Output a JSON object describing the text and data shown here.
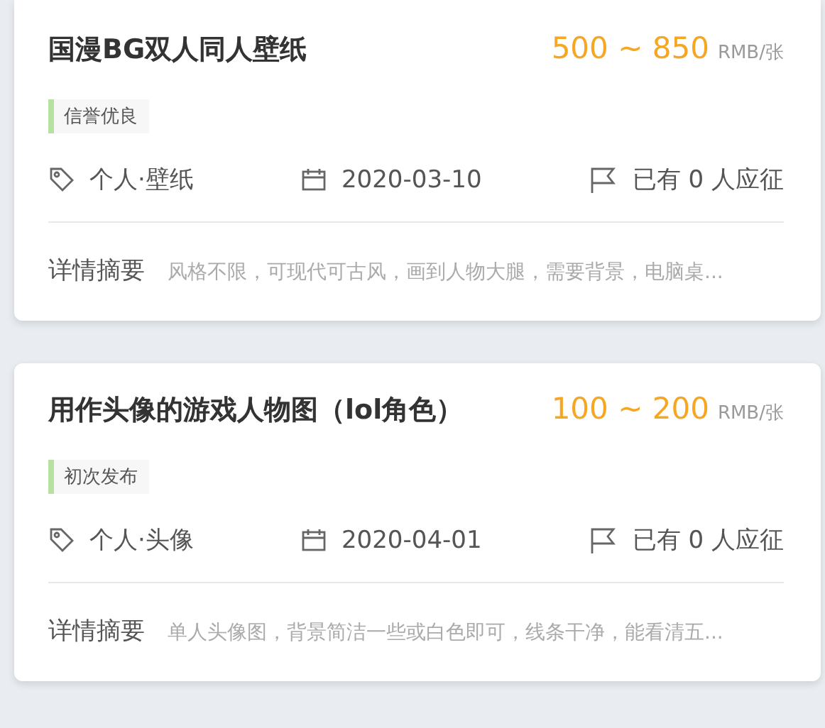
{
  "jobs": [
    {
      "title": "国漫BG双人同人壁纸",
      "price": "500 ~ 850",
      "unit": "RMB/张",
      "badge": "信誉优良",
      "category": "个人·壁纸",
      "date": "2020-03-10",
      "applicants": "已有 0 人应征",
      "summary_label": "详情摘要",
      "summary": "风格不限，可现代可古风，画到人物大腿，需要背景，电脑桌..."
    },
    {
      "title": "用作头像的游戏人物图（lol角色）",
      "price": "100 ~ 200",
      "unit": "RMB/张",
      "badge": "初次发布",
      "category": "个人·头像",
      "date": "2020-04-01",
      "applicants": "已有 0 人应征",
      "summary_label": "详情摘要",
      "summary": "单人头像图，背景简洁一些或白色即可，线条干净，能看清五..."
    }
  ]
}
